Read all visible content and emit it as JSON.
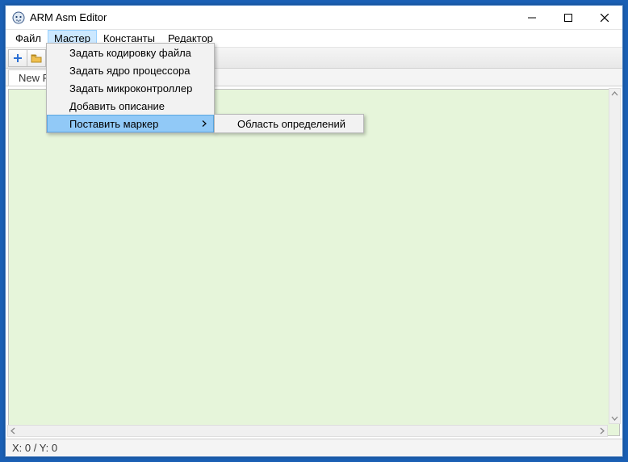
{
  "title": "ARM Asm Editor",
  "menubar": {
    "items": [
      "Файл",
      "Мастер",
      "Константы",
      "Редактор"
    ],
    "active_index": 1
  },
  "toolbar": {
    "buttons": [
      {
        "name": "plus-icon"
      },
      {
        "name": "folder-icon"
      }
    ]
  },
  "tab": {
    "label": "New File"
  },
  "dropdown": {
    "items": [
      "Задать кодировку файла",
      "Задать ядро процессора",
      "Задать микроконтроллер",
      "Добавить описание",
      "Поставить маркер"
    ],
    "hover_index": 4
  },
  "submenu": {
    "items": [
      "Область определений"
    ]
  },
  "status": {
    "text": "X: 0 / Y: 0"
  },
  "window_controls": {
    "minimize": "—",
    "maximize": "☐",
    "close": "✕"
  }
}
